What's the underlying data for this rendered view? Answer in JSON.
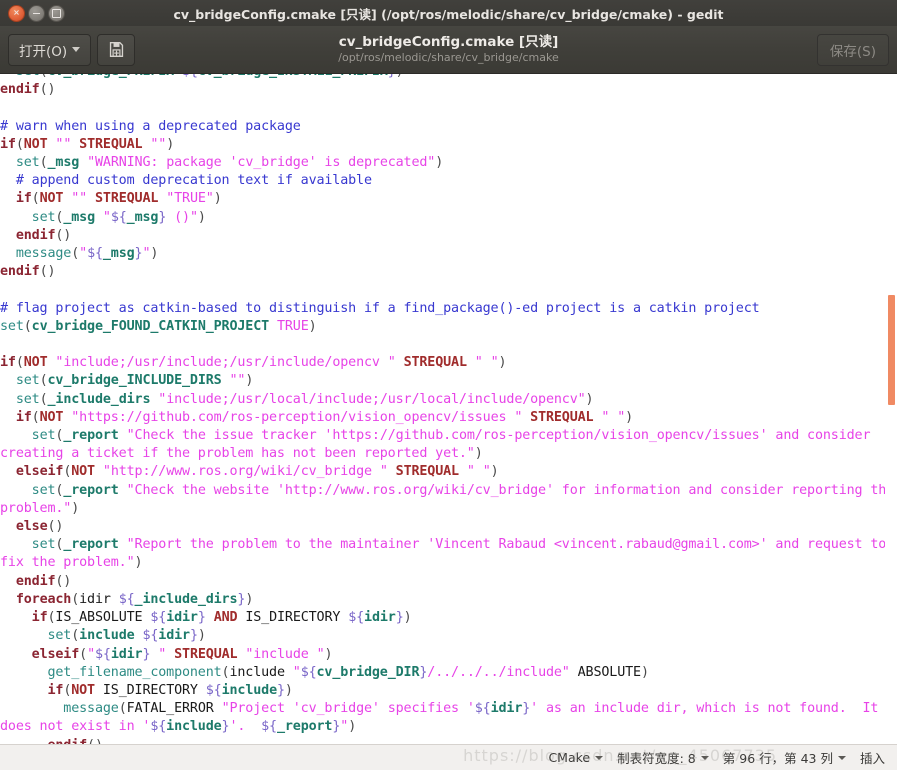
{
  "window": {
    "title": "cv_bridgeConfig.cmake [只读] (/opt/ros/melodic/share/cv_bridge/cmake) - gedit",
    "buttons": {
      "close": "×",
      "minimize": "–",
      "maximize": "□"
    }
  },
  "toolbar": {
    "open_label": "打开(O)",
    "saveas_icon": "save-as-icon",
    "save_label": "保存(S)",
    "doc_title": "cv_bridgeConfig.cmake [只读]",
    "doc_path": "/opt/ros/melodic/share/cv_bridge/cmake"
  },
  "statusbar": {
    "language": "CMake",
    "tab_width": "制表符宽度: 8",
    "position": "第 96 行，第 43 列",
    "insert_mode": "插入",
    "watermark": "https://blog.csdn.net/qq_45067735"
  },
  "editor": {
    "scrollbar_color": "#f08a63",
    "lines": [
      {
        "tokens": [
          {
            "t": "  ",
            "c": "plain"
          },
          {
            "t": "set",
            "c": "cmd"
          },
          {
            "t": "(",
            "c": "paren"
          },
          {
            "t": "cv_bridge_PREFIX ",
            "c": "varn"
          },
          {
            "t": "${",
            "c": "var"
          },
          {
            "t": "cv_bridge_INSTALL_PREFIX",
            "c": "varn"
          },
          {
            "t": "}",
            "c": "var"
          },
          {
            "t": ")",
            "c": "paren"
          }
        ]
      },
      {
        "tokens": [
          {
            "t": "endif",
            "c": "kw"
          },
          {
            "t": "()",
            "c": "paren"
          }
        ]
      },
      {
        "tokens": []
      },
      {
        "tokens": [
          {
            "t": "# warn when using a deprecated package",
            "c": "cmt"
          }
        ]
      },
      {
        "tokens": [
          {
            "t": "if",
            "c": "kw"
          },
          {
            "t": "(",
            "c": "paren"
          },
          {
            "t": "NOT",
            "c": "op"
          },
          {
            "t": " ",
            "c": "plain"
          },
          {
            "t": "\"\"",
            "c": "str"
          },
          {
            "t": " ",
            "c": "plain"
          },
          {
            "t": "STREQUAL",
            "c": "op"
          },
          {
            "t": " ",
            "c": "plain"
          },
          {
            "t": "\"\"",
            "c": "str"
          },
          {
            "t": ")",
            "c": "paren"
          }
        ]
      },
      {
        "tokens": [
          {
            "t": "  ",
            "c": "plain"
          },
          {
            "t": "set",
            "c": "cmd"
          },
          {
            "t": "(",
            "c": "paren"
          },
          {
            "t": "_msg",
            "c": "varn"
          },
          {
            "t": " ",
            "c": "plain"
          },
          {
            "t": "\"WARNING: package 'cv_bridge' is deprecated\"",
            "c": "str"
          },
          {
            "t": ")",
            "c": "paren"
          }
        ]
      },
      {
        "tokens": [
          {
            "t": "  # append custom deprecation text if available",
            "c": "cmt"
          }
        ]
      },
      {
        "tokens": [
          {
            "t": "  ",
            "c": "plain"
          },
          {
            "t": "if",
            "c": "kw"
          },
          {
            "t": "(",
            "c": "paren"
          },
          {
            "t": "NOT",
            "c": "op"
          },
          {
            "t": " ",
            "c": "plain"
          },
          {
            "t": "\"\"",
            "c": "str"
          },
          {
            "t": " ",
            "c": "plain"
          },
          {
            "t": "STREQUAL",
            "c": "op"
          },
          {
            "t": " ",
            "c": "plain"
          },
          {
            "t": "\"TRUE\"",
            "c": "str"
          },
          {
            "t": ")",
            "c": "paren"
          }
        ]
      },
      {
        "tokens": [
          {
            "t": "    ",
            "c": "plain"
          },
          {
            "t": "set",
            "c": "cmd"
          },
          {
            "t": "(",
            "c": "paren"
          },
          {
            "t": "_msg",
            "c": "varn"
          },
          {
            "t": " ",
            "c": "plain"
          },
          {
            "t": "\"",
            "c": "str"
          },
          {
            "t": "${",
            "c": "var"
          },
          {
            "t": "_msg",
            "c": "varn"
          },
          {
            "t": "}",
            "c": "var"
          },
          {
            "t": " ()\"",
            "c": "str"
          },
          {
            "t": ")",
            "c": "paren"
          }
        ]
      },
      {
        "tokens": [
          {
            "t": "  ",
            "c": "plain"
          },
          {
            "t": "endif",
            "c": "kw"
          },
          {
            "t": "()",
            "c": "paren"
          }
        ]
      },
      {
        "tokens": [
          {
            "t": "  ",
            "c": "plain"
          },
          {
            "t": "message",
            "c": "cmd"
          },
          {
            "t": "(",
            "c": "paren"
          },
          {
            "t": "\"",
            "c": "str"
          },
          {
            "t": "${",
            "c": "var"
          },
          {
            "t": "_msg",
            "c": "varn"
          },
          {
            "t": "}",
            "c": "var"
          },
          {
            "t": "\"",
            "c": "str"
          },
          {
            "t": ")",
            "c": "paren"
          }
        ]
      },
      {
        "tokens": [
          {
            "t": "endif",
            "c": "kw"
          },
          {
            "t": "()",
            "c": "paren"
          }
        ]
      },
      {
        "tokens": []
      },
      {
        "tokens": [
          {
            "t": "# flag project as catkin-based to distinguish if a find_package()-ed project is a catkin project",
            "c": "cmt"
          }
        ]
      },
      {
        "tokens": [
          {
            "t": "set",
            "c": "cmd"
          },
          {
            "t": "(",
            "c": "paren"
          },
          {
            "t": "cv_bridge_FOUND_CATKIN_PROJECT ",
            "c": "varn"
          },
          {
            "t": "TRUE",
            "c": "val"
          },
          {
            "t": ")",
            "c": "paren"
          }
        ]
      },
      {
        "tokens": []
      },
      {
        "tokens": [
          {
            "t": "if",
            "c": "kw"
          },
          {
            "t": "(",
            "c": "paren"
          },
          {
            "t": "NOT",
            "c": "op"
          },
          {
            "t": " ",
            "c": "plain"
          },
          {
            "t": "\"include;/usr/include;/usr/include/opencv \"",
            "c": "str"
          },
          {
            "t": " ",
            "c": "plain"
          },
          {
            "t": "STREQUAL",
            "c": "op"
          },
          {
            "t": " ",
            "c": "plain"
          },
          {
            "t": "\" \"",
            "c": "str"
          },
          {
            "t": ")",
            "c": "paren"
          }
        ]
      },
      {
        "tokens": [
          {
            "t": "  ",
            "c": "plain"
          },
          {
            "t": "set",
            "c": "cmd"
          },
          {
            "t": "(",
            "c": "paren"
          },
          {
            "t": "cv_bridge_INCLUDE_DIRS ",
            "c": "varn"
          },
          {
            "t": "\"\"",
            "c": "str"
          },
          {
            "t": ")",
            "c": "paren"
          }
        ]
      },
      {
        "tokens": [
          {
            "t": "  ",
            "c": "plain"
          },
          {
            "t": "set",
            "c": "cmd"
          },
          {
            "t": "(",
            "c": "paren"
          },
          {
            "t": "_include_dirs ",
            "c": "varn"
          },
          {
            "t": "\"include;/usr/local/include;/usr/local/include/opencv\"",
            "c": "str"
          },
          {
            "t": ")",
            "c": "paren"
          }
        ]
      },
      {
        "tokens": [
          {
            "t": "  ",
            "c": "plain"
          },
          {
            "t": "if",
            "c": "kw"
          },
          {
            "t": "(",
            "c": "paren"
          },
          {
            "t": "NOT",
            "c": "op"
          },
          {
            "t": " ",
            "c": "plain"
          },
          {
            "t": "\"https://github.com/ros-perception/vision_opencv/issues \"",
            "c": "str"
          },
          {
            "t": " ",
            "c": "plain"
          },
          {
            "t": "STREQUAL",
            "c": "op"
          },
          {
            "t": " ",
            "c": "plain"
          },
          {
            "t": "\" \"",
            "c": "str"
          },
          {
            "t": ")",
            "c": "paren"
          }
        ]
      },
      {
        "tokens": [
          {
            "t": "    ",
            "c": "plain"
          },
          {
            "t": "set",
            "c": "cmd"
          },
          {
            "t": "(",
            "c": "paren"
          },
          {
            "t": "_report",
            "c": "varn"
          },
          {
            "t": " ",
            "c": "plain"
          },
          {
            "t": "\"Check the issue tracker 'https://github.com/ros-perception/vision_opencv/issues' and consider creating a ticket if the problem has not been reported yet.\"",
            "c": "str"
          },
          {
            "t": ")",
            "c": "paren"
          }
        ]
      },
      {
        "tokens": [
          {
            "t": "  ",
            "c": "plain"
          },
          {
            "t": "elseif",
            "c": "kw"
          },
          {
            "t": "(",
            "c": "paren"
          },
          {
            "t": "NOT",
            "c": "op"
          },
          {
            "t": " ",
            "c": "plain"
          },
          {
            "t": "\"http://www.ros.org/wiki/cv_bridge \"",
            "c": "str"
          },
          {
            "t": " ",
            "c": "plain"
          },
          {
            "t": "STREQUAL",
            "c": "op"
          },
          {
            "t": " ",
            "c": "plain"
          },
          {
            "t": "\" \"",
            "c": "str"
          },
          {
            "t": ")",
            "c": "paren"
          }
        ]
      },
      {
        "tokens": [
          {
            "t": "    ",
            "c": "plain"
          },
          {
            "t": "set",
            "c": "cmd"
          },
          {
            "t": "(",
            "c": "paren"
          },
          {
            "t": "_report",
            "c": "varn"
          },
          {
            "t": " ",
            "c": "plain"
          },
          {
            "t": "\"Check the website 'http://www.ros.org/wiki/cv_bridge' for information and consider reporting the problem.\"",
            "c": "str"
          },
          {
            "t": ")",
            "c": "paren"
          }
        ]
      },
      {
        "tokens": [
          {
            "t": "  ",
            "c": "plain"
          },
          {
            "t": "else",
            "c": "kw"
          },
          {
            "t": "()",
            "c": "paren"
          }
        ]
      },
      {
        "tokens": [
          {
            "t": "    ",
            "c": "plain"
          },
          {
            "t": "set",
            "c": "cmd"
          },
          {
            "t": "(",
            "c": "paren"
          },
          {
            "t": "_report",
            "c": "varn"
          },
          {
            "t": " ",
            "c": "plain"
          },
          {
            "t": "\"Report the problem to the maintainer 'Vincent Rabaud <vincent.rabaud@gmail.com>' and request to fix the problem.\"",
            "c": "str"
          },
          {
            "t": ")",
            "c": "paren"
          }
        ]
      },
      {
        "tokens": [
          {
            "t": "  ",
            "c": "plain"
          },
          {
            "t": "endif",
            "c": "kw"
          },
          {
            "t": "()",
            "c": "paren"
          }
        ]
      },
      {
        "tokens": [
          {
            "t": "  ",
            "c": "plain"
          },
          {
            "t": "foreach",
            "c": "kw"
          },
          {
            "t": "(",
            "c": "paren"
          },
          {
            "t": "idir ",
            "c": "plain"
          },
          {
            "t": "${",
            "c": "var"
          },
          {
            "t": "_include_dirs",
            "c": "varn"
          },
          {
            "t": "}",
            "c": "var"
          },
          {
            "t": ")",
            "c": "paren"
          }
        ]
      },
      {
        "tokens": [
          {
            "t": "    ",
            "c": "plain"
          },
          {
            "t": "if",
            "c": "kw"
          },
          {
            "t": "(",
            "c": "paren"
          },
          {
            "t": "IS_ABSOLUTE ",
            "c": "plain"
          },
          {
            "t": "${",
            "c": "var"
          },
          {
            "t": "idir",
            "c": "varn"
          },
          {
            "t": "}",
            "c": "var"
          },
          {
            "t": " ",
            "c": "plain"
          },
          {
            "t": "AND",
            "c": "op"
          },
          {
            "t": " IS_DIRECTORY ",
            "c": "plain"
          },
          {
            "t": "${",
            "c": "var"
          },
          {
            "t": "idir",
            "c": "varn"
          },
          {
            "t": "}",
            "c": "var"
          },
          {
            "t": ")",
            "c": "paren"
          }
        ]
      },
      {
        "tokens": [
          {
            "t": "      ",
            "c": "plain"
          },
          {
            "t": "set",
            "c": "cmd"
          },
          {
            "t": "(",
            "c": "paren"
          },
          {
            "t": "include ",
            "c": "varn"
          },
          {
            "t": "${",
            "c": "var"
          },
          {
            "t": "idir",
            "c": "varn"
          },
          {
            "t": "}",
            "c": "var"
          },
          {
            "t": ")",
            "c": "paren"
          }
        ]
      },
      {
        "tokens": [
          {
            "t": "    ",
            "c": "plain"
          },
          {
            "t": "elseif",
            "c": "kw"
          },
          {
            "t": "(",
            "c": "paren"
          },
          {
            "t": "\"",
            "c": "str"
          },
          {
            "t": "${",
            "c": "var"
          },
          {
            "t": "idir",
            "c": "varn"
          },
          {
            "t": "}",
            "c": "var"
          },
          {
            "t": " \"",
            "c": "str"
          },
          {
            "t": " ",
            "c": "plain"
          },
          {
            "t": "STREQUAL",
            "c": "op"
          },
          {
            "t": " ",
            "c": "plain"
          },
          {
            "t": "\"include \"",
            "c": "str"
          },
          {
            "t": ")",
            "c": "paren"
          }
        ]
      },
      {
        "tokens": [
          {
            "t": "      ",
            "c": "plain"
          },
          {
            "t": "get_filename_component",
            "c": "cmd"
          },
          {
            "t": "(",
            "c": "paren"
          },
          {
            "t": "include ",
            "c": "plain"
          },
          {
            "t": "\"",
            "c": "str"
          },
          {
            "t": "${",
            "c": "var"
          },
          {
            "t": "cv_bridge_DIR",
            "c": "varn"
          },
          {
            "t": "}",
            "c": "var"
          },
          {
            "t": "/../../../include\"",
            "c": "str"
          },
          {
            "t": " ABSOLUTE",
            "c": "plain"
          },
          {
            "t": ")",
            "c": "paren"
          }
        ]
      },
      {
        "tokens": [
          {
            "t": "      ",
            "c": "plain"
          },
          {
            "t": "if",
            "c": "kw"
          },
          {
            "t": "(",
            "c": "paren"
          },
          {
            "t": "NOT",
            "c": "op"
          },
          {
            "t": " IS_DIRECTORY ",
            "c": "plain"
          },
          {
            "t": "${",
            "c": "var"
          },
          {
            "t": "include",
            "c": "varn"
          },
          {
            "t": "}",
            "c": "var"
          },
          {
            "t": ")",
            "c": "paren"
          }
        ]
      },
      {
        "tokens": [
          {
            "t": "        ",
            "c": "plain"
          },
          {
            "t": "message",
            "c": "cmd"
          },
          {
            "t": "(",
            "c": "paren"
          },
          {
            "t": "FATAL_ERROR ",
            "c": "plain"
          },
          {
            "t": "\"Project 'cv_bridge' specifies '",
            "c": "str"
          },
          {
            "t": "${",
            "c": "var"
          },
          {
            "t": "idir",
            "c": "varn"
          },
          {
            "t": "}",
            "c": "var"
          },
          {
            "t": "' as an include dir, which is not found.  It does not exist in '",
            "c": "str"
          },
          {
            "t": "${",
            "c": "var"
          },
          {
            "t": "include",
            "c": "varn"
          },
          {
            "t": "}",
            "c": "var"
          },
          {
            "t": "'.  ",
            "c": "str"
          },
          {
            "t": "${",
            "c": "var"
          },
          {
            "t": "_report",
            "c": "varn"
          },
          {
            "t": "}",
            "c": "var"
          },
          {
            "t": "\"",
            "c": "str"
          },
          {
            "t": ")",
            "c": "paren"
          }
        ]
      },
      {
        "tokens": [
          {
            "t": "      ",
            "c": "plain"
          },
          {
            "t": "endif",
            "c": "kw"
          },
          {
            "t": "()",
            "c": "paren"
          }
        ]
      }
    ]
  }
}
